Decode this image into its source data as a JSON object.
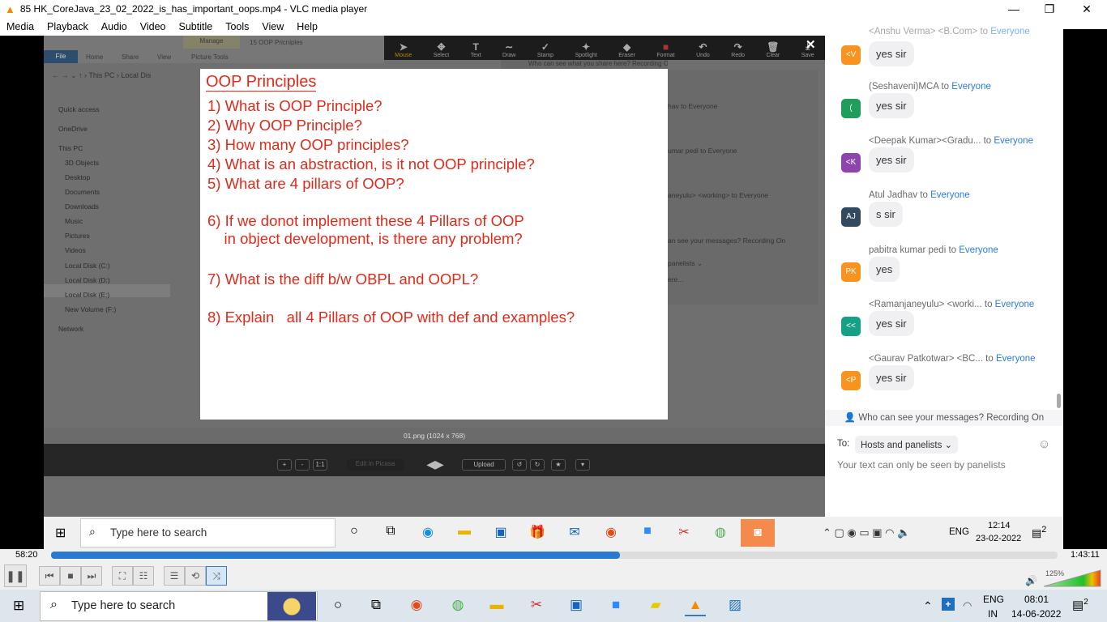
{
  "window": {
    "title": "85 HK_CoreJava_23_02_2022_is_has_important_oops.mp4 - VLC media player",
    "minimize": "—",
    "maximize": "❐",
    "close": "✕"
  },
  "menu": [
    "Media",
    "Playback",
    "Audio",
    "Video",
    "Subtitle",
    "Tools",
    "View",
    "Help"
  ],
  "explorer": {
    "tab_file": "File",
    "tab_home": "Home",
    "tab_share": "Share",
    "tab_view": "View",
    "manage": "Manage",
    "picture_tools": "Picture Tools",
    "folder_title": "15 OOP Pricniples",
    "path": "›  This PC  ›  Local Dis",
    "sidebar": [
      "Quick access",
      "OneDrive",
      "This PC",
      "3D Objects",
      "Desktop",
      "Documents",
      "Downloads",
      "Music",
      "Pictures",
      "Videos",
      "Local Disk (C:)",
      "Local Disk (D:)",
      "Local Disk (E:)",
      "New Volume (F:)",
      "Network"
    ]
  },
  "annotate_toolbar": [
    "Mouse",
    "Select",
    "Text",
    "Draw",
    "Stamp",
    "Spotlight",
    "Eraser",
    "Format",
    "Undo",
    "Redo",
    "Clear",
    "Save"
  ],
  "share_banner": "Who can see what you share here? Recording On",
  "bg_chat": {
    "lines": [
      "hav to Everyone",
      "umar pedi to Everyone",
      "aneyulu> <working> to Everyone"
    ],
    "banner": "an see your messages? Recording On",
    "to": "panelists ⌄",
    "placeholder": "ere..."
  },
  "slide": {
    "title": "OOP Principles",
    "questions": [
      "1) What is OOP Principle?",
      "2) Why OOP Principle?",
      "3) How many OOP principles?",
      "4) What is an abstraction, is it not OOP principle?",
      "5) What are 4 pillars of OOP?",
      "6) If we donot implement these 4 Pillars of OOP\n    in object development, is there any problem?",
      "7) What is the diff b/w OBPL and OOPL?",
      "8) Explain   all 4 Pillars of OOP with def and examples?"
    ]
  },
  "picasa": {
    "filename": "01.png (1024 x 768)",
    "zoom_in": "+",
    "zoom_out": "-",
    "one_to_one": "1:1",
    "edit": "Edit in Picasa",
    "upload": "Upload"
  },
  "chat": {
    "messages": [
      {
        "from": "<Anshu Verma> <B.Com>",
        "to": "Everyone",
        "initials": "<V",
        "color": "#f7931e",
        "text": "yes sir"
      },
      {
        "from": "(Seshaveni)MCA",
        "to": "Everyone",
        "initials": "(",
        "color": "#1e9e5a",
        "text": "yes sir"
      },
      {
        "from": "<Deepak Kumar><Gradu...",
        "to": "Everyone",
        "initials": "<K",
        "color": "#8e44ad",
        "text": "yes sir"
      },
      {
        "from": "Atul Jadhav",
        "to": "Everyone",
        "initials": "AJ",
        "color": "#34495e",
        "text": "s sir"
      },
      {
        "from": "pabitra kumar pedi",
        "to": "Everyone",
        "initials": "PK",
        "color": "#f7931e",
        "text": "yes"
      },
      {
        "from": "<Ramanjaneyulu> <worki...",
        "to": "Everyone",
        "initials": "<<",
        "color": "#16a085",
        "text": "yes sir"
      },
      {
        "from": "<Gaurav Patkotwar> <BC...",
        "to": "Everyone",
        "initials": "<P",
        "color": "#f7931e",
        "text": "yes sir"
      }
    ],
    "to_word": " to ",
    "banner": "Who can see your messages? Recording On",
    "to_label": "To:",
    "recipient": "Hosts and panelists ⌄",
    "placeholder": "Your text can only be seen by panelists"
  },
  "rec_taskbar": {
    "search": "Type here to search",
    "lang": "ENG",
    "time": "12:14",
    "date": "23-02-2022",
    "notif": "2"
  },
  "player": {
    "elapsed": "58:20",
    "total": "1:43:11",
    "progress": 0.565,
    "volume": "125%",
    "volume_level": 1.0
  },
  "taskbar": {
    "search": "Type here to search",
    "lang": "ENG",
    "region": "IN",
    "time": "08:01",
    "date": "14-06-2022",
    "notif": "2"
  }
}
